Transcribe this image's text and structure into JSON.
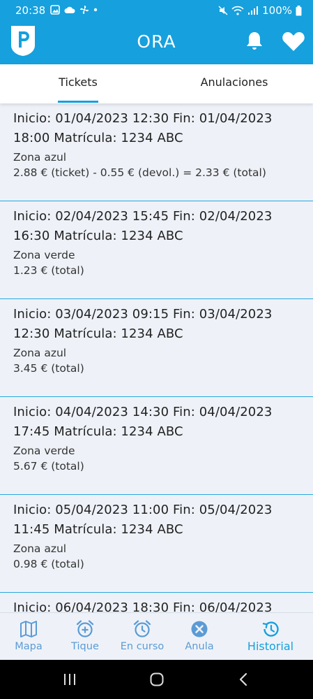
{
  "status_bar": {
    "time": "20:38",
    "battery": "100%"
  },
  "app_bar": {
    "title": "ORA"
  },
  "tabs": [
    {
      "label": "Tickets",
      "active": true
    },
    {
      "label": "Anulaciones",
      "active": false
    }
  ],
  "tickets": [
    {
      "line1": "Inicio: 01/04/2023 12:30 Fin: 01/04/2023",
      "line2": "18:00 Matrícula: 1234 ABC",
      "zone": "Zona azul",
      "price": "2.88 € (ticket) - 0.55 € (devol.) = 2.33 € (total)"
    },
    {
      "line1": "Inicio: 02/04/2023 15:45 Fin: 02/04/2023",
      "line2": "16:30 Matrícula: 1234 ABC",
      "zone": "Zona verde",
      "price": "1.23 € (total)"
    },
    {
      "line1": "Inicio: 03/04/2023 09:15 Fin: 03/04/2023",
      "line2": "12:30 Matrícula: 1234 ABC",
      "zone": "Zona azul",
      "price": "3.45 € (total)"
    },
    {
      "line1": "Inicio: 04/04/2023 14:30 Fin: 04/04/2023",
      "line2": "17:45 Matrícula: 1234 ABC",
      "zone": "Zona verde",
      "price": "5.67 € (total)"
    },
    {
      "line1": "Inicio: 05/04/2023 11:00 Fin: 05/04/2023",
      "line2": "11:45 Matrícula: 1234 ABC",
      "zone": "Zona azul",
      "price": "0.98 € (total)"
    },
    {
      "line1": "Inicio: 06/04/2023 18:30 Fin: 06/04/2023",
      "line2": "",
      "zone": "",
      "price": ""
    }
  ],
  "bottom_nav": [
    {
      "label": "Mapa",
      "icon": "map-icon"
    },
    {
      "label": "Tique",
      "icon": "alarm-add-icon"
    },
    {
      "label": "En curso",
      "icon": "alarm-clock-icon"
    },
    {
      "label": "Anula",
      "icon": "cancel-circle-icon"
    },
    {
      "label": "Historial",
      "icon": "history-icon",
      "active": true
    }
  ],
  "colors": {
    "primary": "#16a0dd",
    "background": "#eef2f8",
    "divider": "#27a7dc",
    "nav_inactive": "#5b9bd5"
  }
}
